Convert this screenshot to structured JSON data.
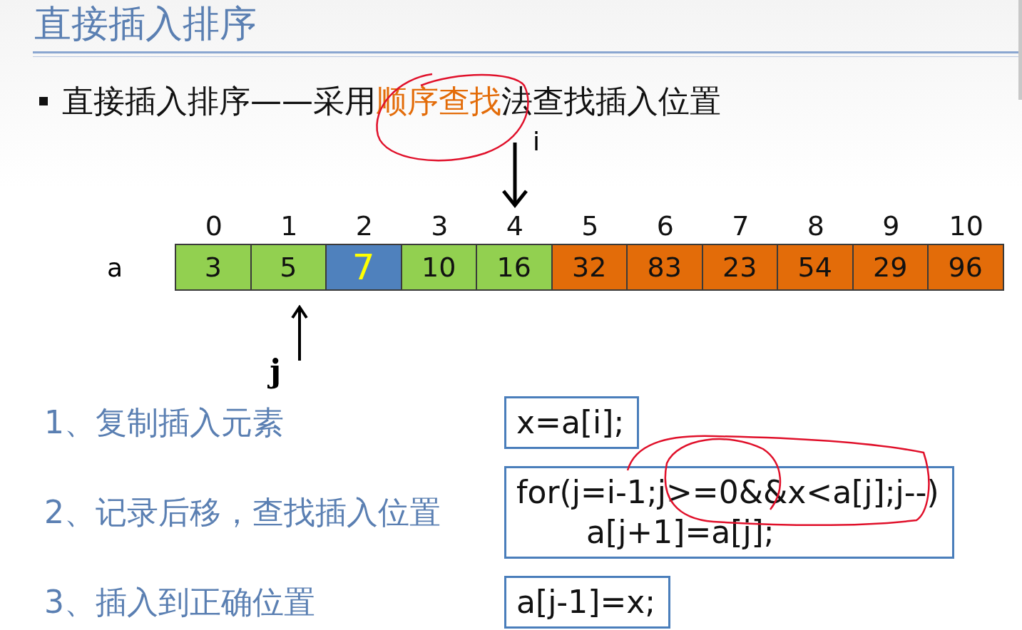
{
  "title": "直接插入排序",
  "bullet": {
    "before": "直接插入排序——采用",
    "highlight": "顺序查找",
    "after": "法查找插入位置"
  },
  "array": {
    "name": "a",
    "cells": [
      {
        "index": "0",
        "value": "3",
        "color": "#92d050",
        "highlighted": false
      },
      {
        "index": "1",
        "value": "5",
        "color": "#92d050",
        "highlighted": false,
        "pointer": {
          "label": "j",
          "kind": "up"
        }
      },
      {
        "index": "2",
        "value": "7",
        "color": "#4f81bd",
        "highlighted": true
      },
      {
        "index": "3",
        "value": "10",
        "color": "#92d050",
        "highlighted": false
      },
      {
        "index": "4",
        "value": "16",
        "color": "#92d050",
        "highlighted": false,
        "pointer": {
          "label": "i",
          "kind": "down"
        }
      },
      {
        "index": "5",
        "value": "32",
        "color": "#e36c09",
        "highlighted": false
      },
      {
        "index": "6",
        "value": "83",
        "color": "#e36c09",
        "highlighted": false
      },
      {
        "index": "7",
        "value": "23",
        "color": "#e36c09",
        "highlighted": false
      },
      {
        "index": "8",
        "value": "54",
        "color": "#e36c09",
        "highlighted": false
      },
      {
        "index": "9",
        "value": "29",
        "color": "#e36c09",
        "highlighted": false
      },
      {
        "index": "10",
        "value": "96",
        "color": "#e36c09",
        "highlighted": false
      }
    ]
  },
  "steps": [
    {
      "label": "1、复制插入元素",
      "code": [
        "x=a[i];"
      ]
    },
    {
      "label": "2、记录后移，查找插入位置",
      "code": [
        "for(j=i-1;j>=0&&x<a[j];j--)",
        "a[j+1]=a[j];"
      ]
    },
    {
      "label": "3、插入到正确位置",
      "code": [
        "a[j-1]=x;"
      ]
    }
  ]
}
